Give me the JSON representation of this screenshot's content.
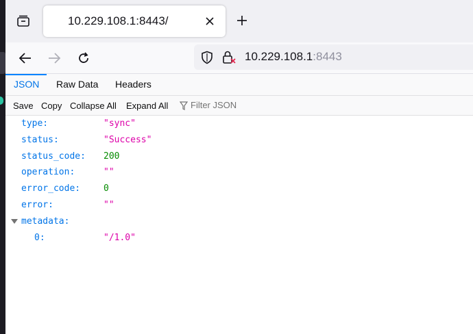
{
  "tab": {
    "title": "10.229.108.1:8443/"
  },
  "urlbar": {
    "host": "10.229.108.1",
    "port": ":8443"
  },
  "viewer_tabs": [
    "JSON",
    "Raw Data",
    "Headers"
  ],
  "toolbar": {
    "save": "Save",
    "copy": "Copy",
    "collapse_all": "Collapse All",
    "expand_all": "Expand All",
    "filter_placeholder": "Filter JSON"
  },
  "json_rows": [
    {
      "key": "type:",
      "value": "\"sync\"",
      "kind": "string"
    },
    {
      "key": "status:",
      "value": "\"Success\"",
      "kind": "string"
    },
    {
      "key": "status_code:",
      "value": "200",
      "kind": "number"
    },
    {
      "key": "operation:",
      "value": "\"\"",
      "kind": "string"
    },
    {
      "key": "error_code:",
      "value": "0",
      "kind": "number"
    },
    {
      "key": "error:",
      "value": "\"\"",
      "kind": "string"
    },
    {
      "key": "metadata:",
      "value": "",
      "kind": "object"
    },
    {
      "key": "0:",
      "value": "\"/1.0\"",
      "kind": "string"
    }
  ],
  "colors": {
    "key": "#0074e8",
    "string": "#dd00a9",
    "number": "#058b00",
    "selected_tab": "#0074e8"
  },
  "icons": [
    "tab-list-icon",
    "close-icon",
    "plus-icon",
    "back-arrow-icon",
    "forward-arrow-icon",
    "reload-icon",
    "shield-icon",
    "lock-icon",
    "filter-icon",
    "twisty-expanded-icon"
  ]
}
